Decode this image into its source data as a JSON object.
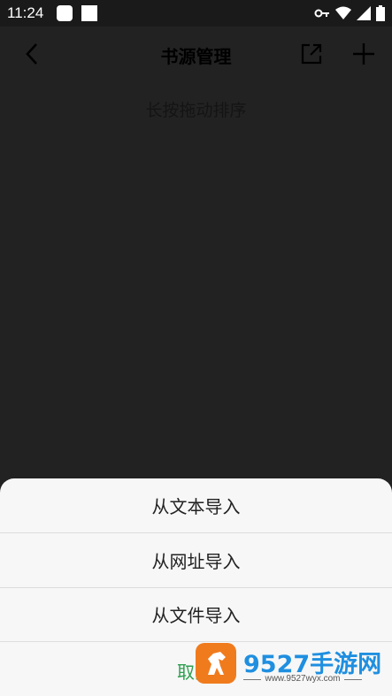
{
  "status_bar": {
    "time": "11:24",
    "icons": [
      "vpn-key-icon",
      "wifi-icon",
      "cellular-signal-icon",
      "battery-icon"
    ]
  },
  "toolbar": {
    "title": "书源管理",
    "back_icon": "chevron-left-icon",
    "share_icon": "external-link-icon",
    "add_icon": "plus-icon"
  },
  "main": {
    "hint": "长按拖动排序"
  },
  "bottom_sheet": {
    "items": [
      {
        "label": "从文本导入"
      },
      {
        "label": "从网址导入"
      },
      {
        "label": "从文件导入"
      }
    ],
    "cancel_label": "取消"
  },
  "watermark": {
    "title": "9527手游网",
    "url": "www.9527wyx.com"
  },
  "colors": {
    "background": "#222222",
    "sheet": "#f7f7f7",
    "cancel": "#2e9e4f",
    "watermark_orange": "#f07b1d",
    "watermark_blue": "#1f8fe0"
  }
}
